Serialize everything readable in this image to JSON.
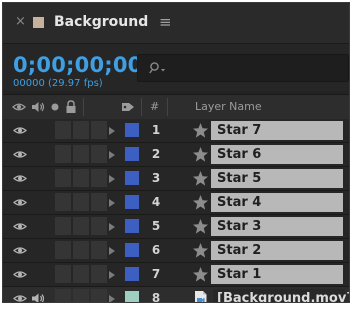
{
  "panel": {
    "tab_title": "Background",
    "accent_color": "#3f9fe2",
    "tab_swatch_color": "#c7b39d"
  },
  "timecode": {
    "value": "0;00;00;00",
    "frame_info": "00000 (29.97 fps)"
  },
  "search": {
    "icon": "search-icon"
  },
  "columns": {
    "number_label": "#",
    "layer_name_label": "Layer Name"
  },
  "layers": [
    {
      "number": "1",
      "name": "Star 7",
      "label_color": "#3e5fc2",
      "type": "shape"
    },
    {
      "number": "2",
      "name": "Star 6",
      "label_color": "#3e5fc2",
      "type": "shape"
    },
    {
      "number": "3",
      "name": "Star 5",
      "label_color": "#3e5fc2",
      "type": "shape"
    },
    {
      "number": "4",
      "name": "Star 4",
      "label_color": "#3e5fc2",
      "type": "shape"
    },
    {
      "number": "5",
      "name": "Star 3",
      "label_color": "#3e5fc2",
      "type": "shape"
    },
    {
      "number": "6",
      "name": "Star 2",
      "label_color": "#3e5fc2",
      "type": "shape"
    },
    {
      "number": "7",
      "name": "Star 1",
      "label_color": "#3e5fc2",
      "type": "shape"
    },
    {
      "number": "8",
      "name": "[Background.mov]",
      "label_color": "#9fcfc0",
      "type": "footage"
    }
  ]
}
